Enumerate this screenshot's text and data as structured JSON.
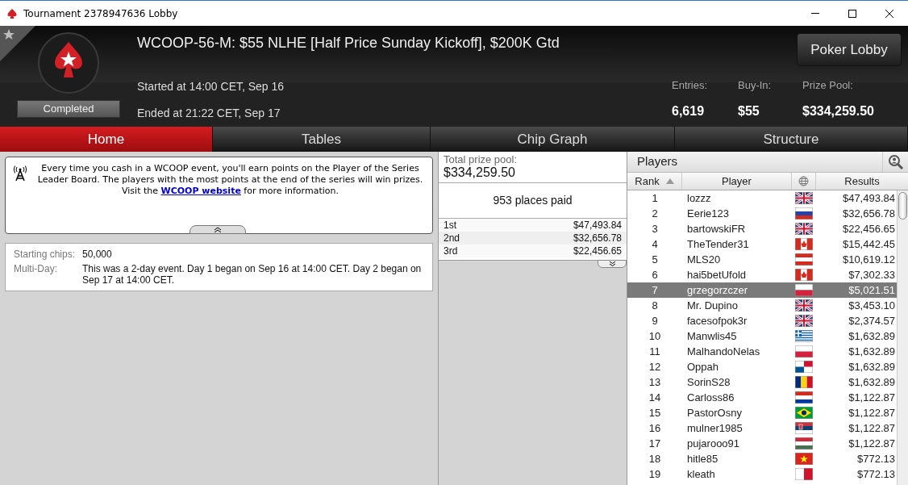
{
  "window": {
    "title": "Tournament 2378947636 Lobby"
  },
  "header": {
    "title": "WCOOP-56-M: $55 NLHE [Half Price Sunday Kickoff], $200K Gtd",
    "status": "Completed",
    "started": "Started at 14:00 CET, Sep 16",
    "ended": "Ended at 21:22 CET, Sep 17",
    "lobby_button": "Poker Lobby",
    "stats": [
      {
        "label": "Entries:",
        "value": "6,619"
      },
      {
        "label": "Buy-In:",
        "value": "$55"
      },
      {
        "label": "Prize Pool:",
        "value": "$334,259.50"
      }
    ]
  },
  "tabs": [
    {
      "label": "Home",
      "selected": true
    },
    {
      "label": "Tables",
      "selected": false
    },
    {
      "label": "Chip Graph",
      "selected": false
    },
    {
      "label": "Structure",
      "selected": false
    }
  ],
  "notice": {
    "before": "Every time you cash in a WCOOP event, you'll earn points on the Player of the Series Leader Board. The players with the most points at the end of the series will win prizes. Visit the",
    "link": "WCOOP website",
    "after": "for more information."
  },
  "details": [
    {
      "label": "Starting chips:",
      "value": "50,000"
    },
    {
      "label": "Multi-Day:",
      "value": "This was a 2-day event. Day 1 began on Sep 16 at 14:00 CET. Day 2 began on Sep 17 at 14:00 CET."
    }
  ],
  "prizes": {
    "label": "Total prize pool:",
    "total": "$334,259.50",
    "places": "953 places paid",
    "rows": [
      {
        "place": "1st",
        "amount": "$47,493.84"
      },
      {
        "place": "2nd",
        "amount": "$32,656.78"
      },
      {
        "place": "3rd",
        "amount": "$22,456.65"
      }
    ]
  },
  "players": {
    "title": "Players",
    "columns": [
      "Rank",
      "Player",
      "Results"
    ],
    "rows": [
      {
        "rank": "1",
        "player": "lozzz",
        "flag": {
          "kind": "gb"
        },
        "result": "$47,493.84",
        "selected": false
      },
      {
        "rank": "2",
        "player": "Eerie123",
        "flag": {
          "kind": "ru"
        },
        "result": "$32,656.78",
        "selected": false
      },
      {
        "rank": "3",
        "player": "bartowskiFR",
        "flag": {
          "kind": "gb"
        },
        "result": "$22,456.65",
        "selected": false
      },
      {
        "rank": "4",
        "player": "TheTender31",
        "flag": {
          "kind": "ca"
        },
        "result": "$15,442.45",
        "selected": false
      },
      {
        "rank": "5",
        "player": "MLS20",
        "flag": {
          "kind": "at"
        },
        "result": "$10,619.12",
        "selected": false
      },
      {
        "rank": "6",
        "player": "hai5betUfold",
        "flag": {
          "kind": "ca"
        },
        "result": "$7,302.33",
        "selected": false
      },
      {
        "rank": "7",
        "player": "grzegorzczer",
        "flag": {
          "kind": "pl"
        },
        "result": "$5,021.51",
        "selected": true
      },
      {
        "rank": "8",
        "player": "Mr. Dupino",
        "flag": {
          "kind": "gb"
        },
        "result": "$3,453.10",
        "selected": false
      },
      {
        "rank": "9",
        "player": "facesofpok3r",
        "flag": {
          "kind": "gb"
        },
        "result": "$2,374.57",
        "selected": false
      },
      {
        "rank": "10",
        "player": "Manwlis45",
        "flag": {
          "kind": "gr"
        },
        "result": "$1,632.89",
        "selected": false
      },
      {
        "rank": "11",
        "player": "MalhandoNelas",
        "flag": {
          "kind": "pl"
        },
        "result": "$1,632.89",
        "selected": false
      },
      {
        "rank": "12",
        "player": "Oppah",
        "flag": {
          "kind": "pa"
        },
        "result": "$1,632.89",
        "selected": false
      },
      {
        "rank": "13",
        "player": "SorinS28",
        "flag": {
          "kind": "ro"
        },
        "result": "$1,632.89",
        "selected": false
      },
      {
        "rank": "14",
        "player": "Carloss86",
        "flag": {
          "kind": "py"
        },
        "result": "$1,122.87",
        "selected": false
      },
      {
        "rank": "15",
        "player": "PastorOsny",
        "flag": {
          "kind": "br"
        },
        "result": "$1,122.87",
        "selected": false
      },
      {
        "rank": "16",
        "player": "mulner1985",
        "flag": {
          "kind": "rs"
        },
        "result": "$1,122.87",
        "selected": false
      },
      {
        "rank": "17",
        "player": "pujarooo91",
        "flag": {
          "kind": "hu"
        },
        "result": "$1,122.87",
        "selected": false
      },
      {
        "rank": "18",
        "player": "hitle85",
        "flag": {
          "kind": "vn"
        },
        "result": "$772.13",
        "selected": false
      },
      {
        "rank": "19",
        "player": "kleath",
        "flag": {
          "kind": "mt"
        },
        "result": "$772.13",
        "selected": false
      }
    ]
  }
}
